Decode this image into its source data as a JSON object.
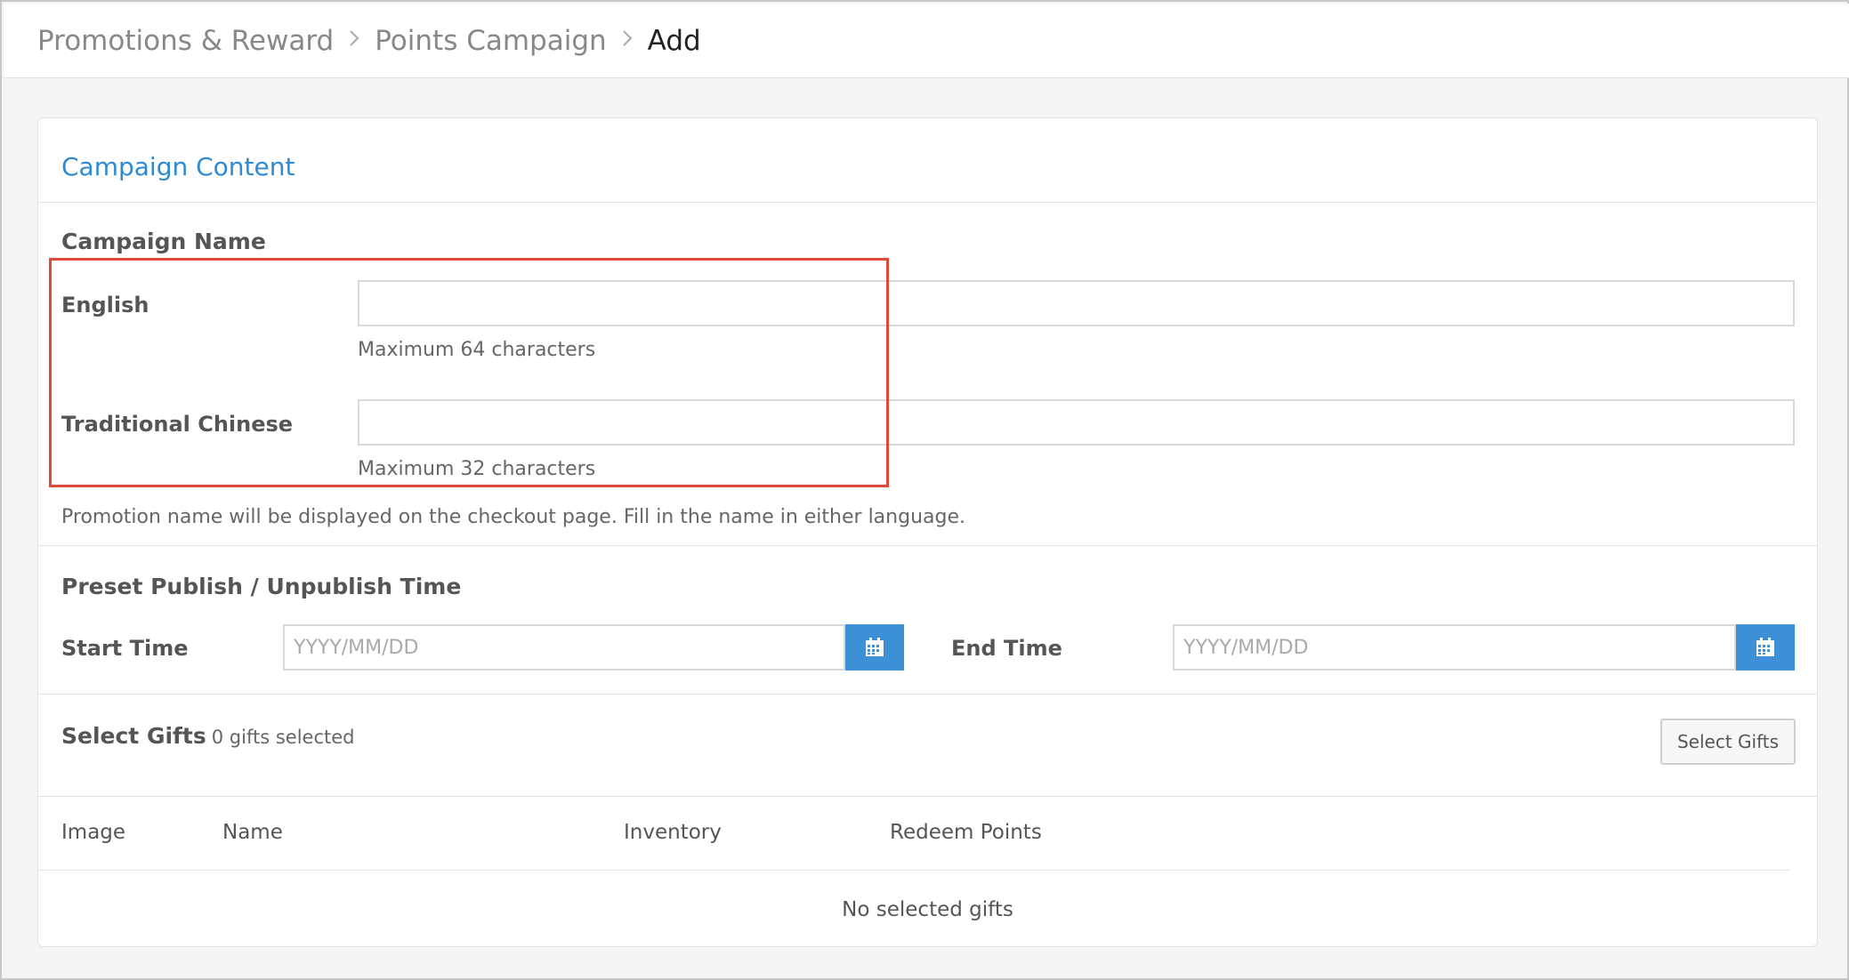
{
  "breadcrumb": {
    "items": [
      "Promotions & Reward",
      "Points Campaign"
    ],
    "current": "Add"
  },
  "section": {
    "title": "Campaign Content"
  },
  "campaign_name": {
    "heading": "Campaign Name",
    "english_label": "English",
    "english_value": "",
    "english_help": "Maximum 64 characters",
    "chinese_label": "Traditional Chinese",
    "chinese_value": "",
    "chinese_help": "Maximum 32 characters",
    "note": "Promotion name will be displayed on the checkout page. Fill in the name in either language."
  },
  "publish": {
    "heading": "Preset Publish / Unpublish Time",
    "start_label": "Start Time",
    "start_placeholder": "YYYY/MM/DD",
    "end_label": "End Time",
    "end_placeholder": "YYYY/MM/DD"
  },
  "gifts": {
    "heading": "Select Gifts",
    "count_text": "0 gifts selected",
    "select_button": "Select Gifts",
    "columns": [
      "Image",
      "Name",
      "Inventory",
      "Redeem Points"
    ],
    "empty_text": "No selected gifts"
  },
  "colors": {
    "accent": "#2d8ad3",
    "calendar_button": "#3d8fd6",
    "highlight_box": "#e14a3b"
  },
  "icons": {
    "breadcrumb_separator": "chevron-right-icon",
    "date_picker": "calendar-icon"
  }
}
